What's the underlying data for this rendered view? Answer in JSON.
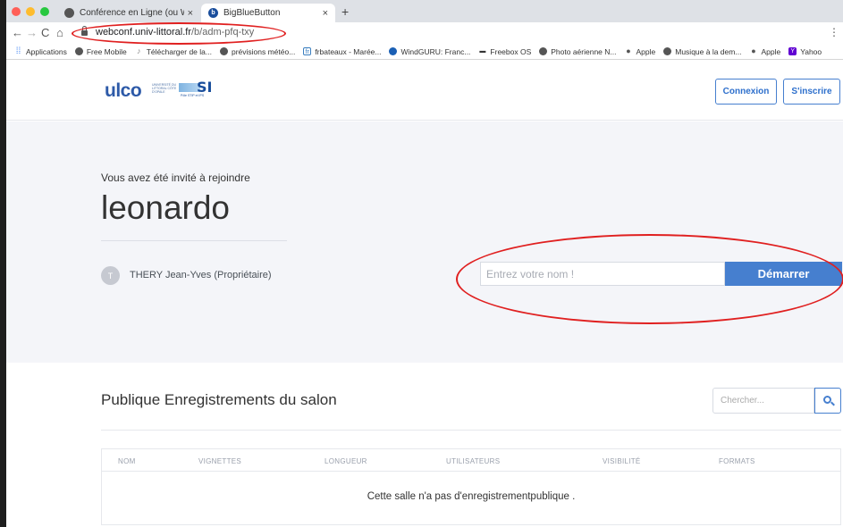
{
  "browser": {
    "tabs": [
      {
        "title": "Conférence en Ligne (ou Web...",
        "active": false
      },
      {
        "title": "BigBlueButton",
        "active": true
      }
    ],
    "new_tab": "+",
    "close": "×",
    "url_host": "webconf.univ-littoral.fr",
    "url_path": "/b/adm-pfq-txy",
    "bookmarks": [
      {
        "label": "Applications",
        "icon": "grid-icon"
      },
      {
        "label": "Free Mobile",
        "icon": "globe-icon"
      },
      {
        "label": "Télécharger de la...",
        "icon": "music-icon"
      },
      {
        "label": "prévisions météo...",
        "icon": "globe-icon"
      },
      {
        "label": "frbateaux - Marée...",
        "icon": "fr-icon"
      },
      {
        "label": "WindGURU: Franc...",
        "icon": "windguru-icon"
      },
      {
        "label": "Freebox OS",
        "icon": "freebox-icon"
      },
      {
        "label": "Photo aérienne N...",
        "icon": "globe-icon"
      },
      {
        "label": "Apple",
        "icon": "apple-icon"
      },
      {
        "label": "Musique à la dem...",
        "icon": "globe-icon"
      },
      {
        "label": "Apple",
        "icon": "apple-icon"
      },
      {
        "label": "Yahoo",
        "icon": "yahoo-icon"
      }
    ]
  },
  "header": {
    "logo_text": "ulco",
    "logo_small": "UNIVERSITÉ DU LITTORAL CÔTE D'OPALE",
    "logo_si": "SI",
    "logo_si_sub": "Pôle STIP et IPS",
    "connexion": "Connexion",
    "inscrire": "S'inscrire"
  },
  "hero": {
    "invite_text": "Vous avez été invité à rejoindre",
    "room_name": "leonardo",
    "owner_initial": "T",
    "owner_name": "THERY Jean-Yves (Propriétaire)",
    "name_placeholder": "Entrez votre nom !",
    "start_label": "Démarrer"
  },
  "recordings": {
    "title": "Publique Enregistrements du salon",
    "search_placeholder": "Chercher...",
    "columns": [
      "NOM",
      "VIGNETTES",
      "LONGUEUR",
      "UTILISATEURS",
      "VISIBILITÉ",
      "FORMATS"
    ],
    "empty_message": "Cette salle n'a pas d'enregistrementpublique ."
  },
  "colors": {
    "primary": "#467fcf",
    "annotation": "#e02020",
    "hero_bg": "#f4f5f9"
  }
}
